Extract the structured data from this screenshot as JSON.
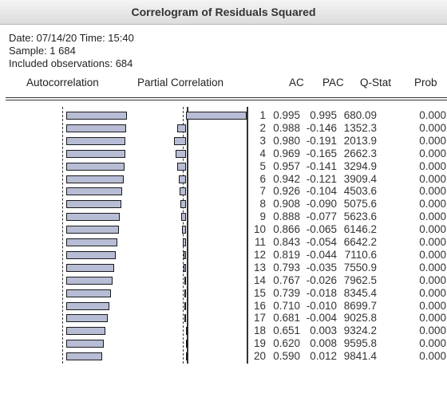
{
  "window": {
    "title": "Correlogram of Residuals Squared"
  },
  "info": {
    "date_line": "Date: 07/14/20   Time: 15:40",
    "sample_line": "Sample: 1 684",
    "obs_line": "Included observations: 684"
  },
  "headers": {
    "autocorrelation": "Autocorrelation",
    "partial_correlation": "Partial Correlation",
    "ac": "AC",
    "pac": "PAC",
    "qstat": "Q-Stat",
    "prob": "Prob"
  },
  "rows": [
    {
      "lag": "1",
      "ac": "0.995",
      "pac": "0.995",
      "q": "680.09",
      "prob": "0.000"
    },
    {
      "lag": "2",
      "ac": "0.988",
      "pac": "-0.146",
      "q": "1352.3",
      "prob": "0.000"
    },
    {
      "lag": "3",
      "ac": "0.980",
      "pac": "-0.191",
      "q": "2013.9",
      "prob": "0.000"
    },
    {
      "lag": "4",
      "ac": "0.969",
      "pac": "-0.165",
      "q": "2662.3",
      "prob": "0.000"
    },
    {
      "lag": "5",
      "ac": "0.957",
      "pac": "-0.141",
      "q": "3294.9",
      "prob": "0.000"
    },
    {
      "lag": "6",
      "ac": "0.942",
      "pac": "-0.121",
      "q": "3909.4",
      "prob": "0.000"
    },
    {
      "lag": "7",
      "ac": "0.926",
      "pac": "-0.104",
      "q": "4503.6",
      "prob": "0.000"
    },
    {
      "lag": "8",
      "ac": "0.908",
      "pac": "-0.090",
      "q": "5075.6",
      "prob": "0.000"
    },
    {
      "lag": "9",
      "ac": "0.888",
      "pac": "-0.077",
      "q": "5623.6",
      "prob": "0.000"
    },
    {
      "lag": "10",
      "ac": "0.866",
      "pac": "-0.065",
      "q": "6146.2",
      "prob": "0.000"
    },
    {
      "lag": "11",
      "ac": "0.843",
      "pac": "-0.054",
      "q": "6642.2",
      "prob": "0.000"
    },
    {
      "lag": "12",
      "ac": "0.819",
      "pac": "-0.044",
      "q": "7110.6",
      "prob": "0.000"
    },
    {
      "lag": "13",
      "ac": "0.793",
      "pac": "-0.035",
      "q": "7550.9",
      "prob": "0.000"
    },
    {
      "lag": "14",
      "ac": "0.767",
      "pac": "-0.026",
      "q": "7962.5",
      "prob": "0.000"
    },
    {
      "lag": "15",
      "ac": "0.739",
      "pac": "-0.018",
      "q": "8345.4",
      "prob": "0.000"
    },
    {
      "lag": "16",
      "ac": "0.710",
      "pac": "-0.010",
      "q": "8699.7",
      "prob": "0.000"
    },
    {
      "lag": "17",
      "ac": "0.681",
      "pac": "-0.004",
      "q": "9025.8",
      "prob": "0.000"
    },
    {
      "lag": "18",
      "ac": "0.651",
      "pac": "0.003",
      "q": "9324.2",
      "prob": "0.000"
    },
    {
      "lag": "19",
      "ac": "0.620",
      "pac": "0.008",
      "q": "9595.8",
      "prob": "0.000"
    },
    {
      "lag": "20",
      "ac": "0.590",
      "pac": "0.012",
      "q": "9841.4",
      "prob": "0.000"
    }
  ],
  "colors": {
    "bar_fill": "#b8bdd6",
    "bar_border": "#1a1a1a"
  }
}
